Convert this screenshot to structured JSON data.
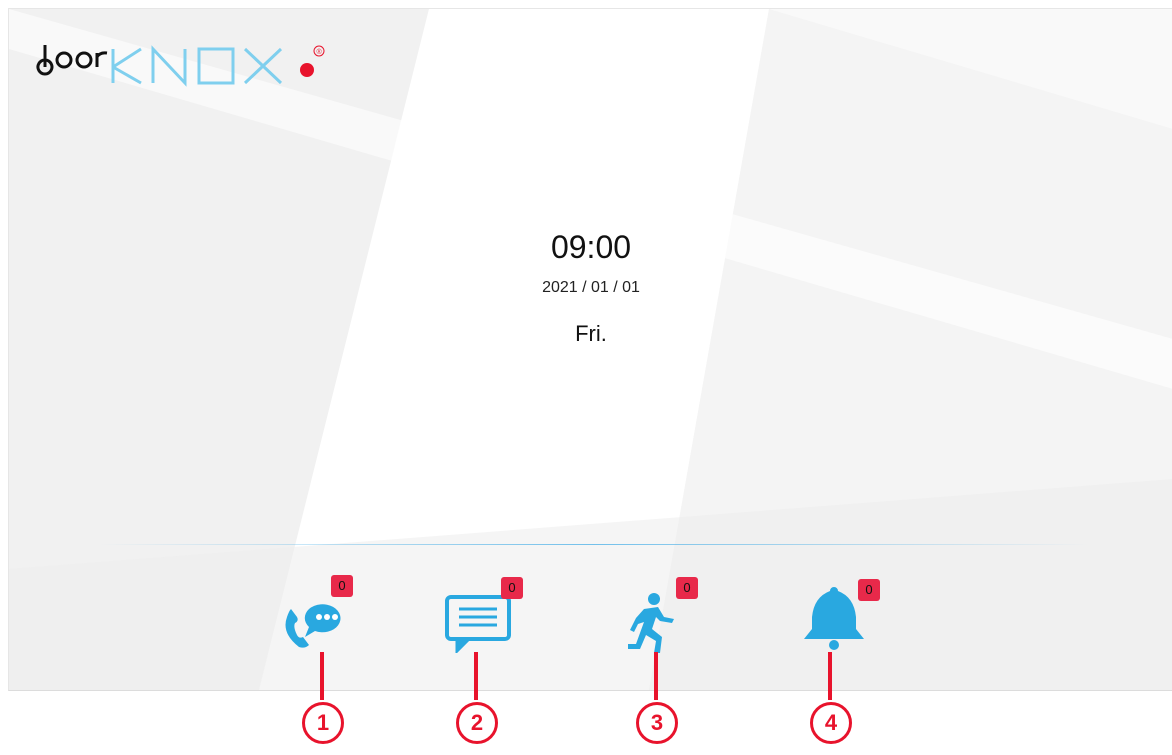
{
  "logo": {
    "alt": "doorKNOX",
    "registered": "®"
  },
  "clock": {
    "time": "09:00",
    "date": "2021 / 01 / 01",
    "day": "Fri."
  },
  "colors": {
    "accent": "#29a8e0",
    "badge": "#e8294a",
    "callout": "#e8132c"
  },
  "buttons": [
    {
      "icon": "phone-chat-icon",
      "badge": "0",
      "callout": "1"
    },
    {
      "icon": "message-icon",
      "badge": "0",
      "callout": "2"
    },
    {
      "icon": "motion-icon",
      "badge": "0",
      "callout": "3"
    },
    {
      "icon": "bell-icon",
      "badge": "0",
      "callout": "4"
    }
  ]
}
